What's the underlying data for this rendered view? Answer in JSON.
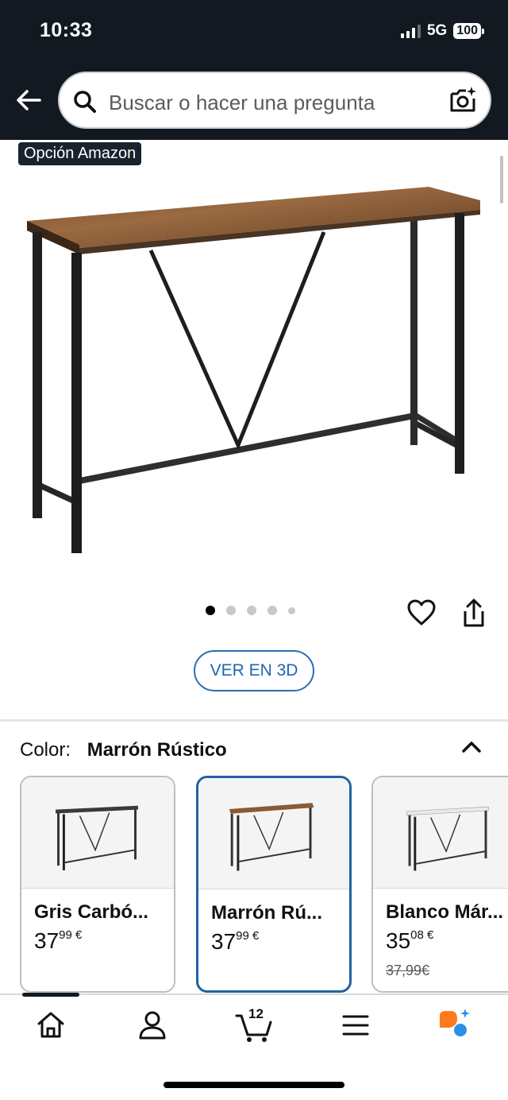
{
  "status_bar": {
    "time": "10:33",
    "network": "5G",
    "battery": "100"
  },
  "search": {
    "placeholder": "Buscar o hacer una pregunta"
  },
  "badge": "Opción Amazon",
  "product": {
    "image_count": 5,
    "active_image": 1,
    "view_3d_label": "VER EN 3D"
  },
  "color_selector": {
    "label": "Color:",
    "selected_value": "Marrón Rústico",
    "options": [
      {
        "name": "Gris Carbó...",
        "price_int": "37",
        "price_dec": "99",
        "currency": "€",
        "old_price": ""
      },
      {
        "name": "Marrón Rú...",
        "price_int": "37",
        "price_dec": "99",
        "currency": "€",
        "old_price": ""
      },
      {
        "name": "Blanco Már...",
        "price_int": "35",
        "price_dec": "08",
        "currency": "€",
        "old_price": "37,99€"
      }
    ]
  },
  "bottom_nav": {
    "cart_count": "12"
  },
  "colors": {
    "header": "#131921",
    "link_blue": "#1f67b1",
    "selected_border": "#2162a1",
    "wood": "#8a5a34"
  }
}
